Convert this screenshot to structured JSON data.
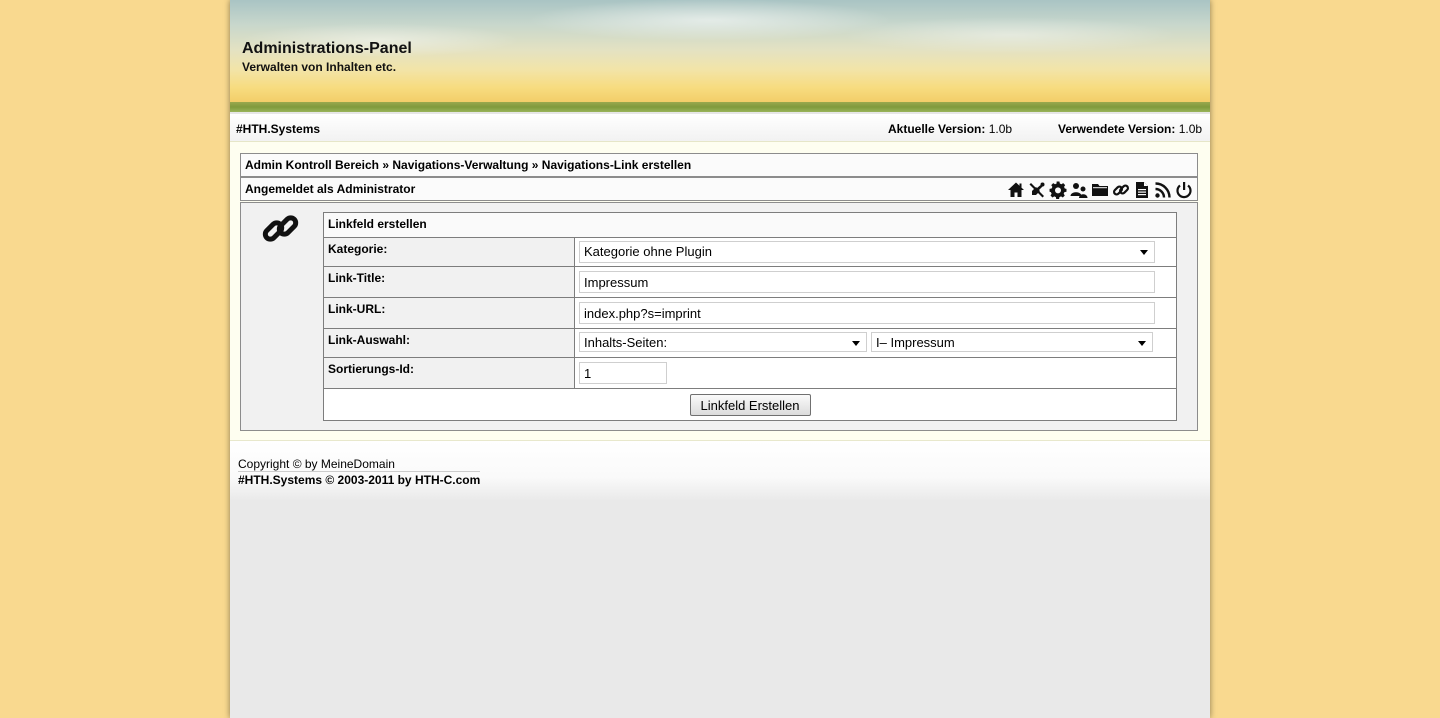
{
  "header": {
    "title": "Administrations-Panel",
    "subtitle": "Verwalten von Inhalten etc."
  },
  "infobar": {
    "brand": "#HTH.Systems",
    "current_version_label": "Aktuelle Version:",
    "current_version": "1.0b",
    "used_version_label": "Verwendete Version:",
    "used_version": "1.0b"
  },
  "breadcrumb": {
    "items": [
      "Admin Kontroll Bereich",
      "Navigations-Verwaltung",
      "Navigations-Link erstellen"
    ],
    "separator": "»"
  },
  "userbar": {
    "logged_in_text": "Angemeldet als Administrator",
    "icons": [
      "home-icon",
      "tools-icon",
      "gear-icon",
      "users-icon",
      "folder-icon",
      "link-icon",
      "document-icon",
      "rss-icon",
      "power-icon"
    ]
  },
  "form": {
    "heading": "Linkfeld erstellen",
    "category_label": "Kategorie:",
    "category_value": "Kategorie ohne Plugin",
    "title_label": "Link-Title:",
    "title_value": "Impressum",
    "url_label": "Link-URL:",
    "url_value": "index.php?s=imprint",
    "choice_label": "Link-Auswahl:",
    "choice_type_value": "Inhalts-Seiten:",
    "choice_page_value": "I– Impressum",
    "sort_label": "Sortierungs-Id:",
    "sort_value": "1",
    "submit_label": "Linkfeld Erstellen"
  },
  "footer": {
    "copyright": "Copyright © by MeineDomain",
    "system": "#HTH.Systems © 2003-2011 by HTH-C.com"
  }
}
